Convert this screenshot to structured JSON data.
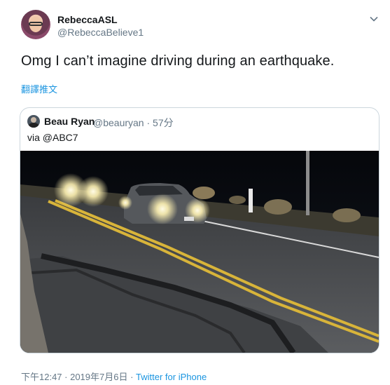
{
  "author": {
    "display_name": "RebeccaASL",
    "handle": "@RebeccaBelieve1"
  },
  "tweet": {
    "text": "Omg I can’t imagine driving during an earthquake.",
    "translate_label": "翻譯推文"
  },
  "quoted_tweet": {
    "display_name": "Beau Ryan",
    "handle": "@beauryan",
    "separator": "·",
    "time": "57分",
    "text": "via @ABC7"
  },
  "footer": {
    "timestamp": "下午12:47 · 2019年7月6日 · ",
    "source": "Twitter for iPhone"
  },
  "icons": {
    "more": "chevron-down-icon"
  }
}
